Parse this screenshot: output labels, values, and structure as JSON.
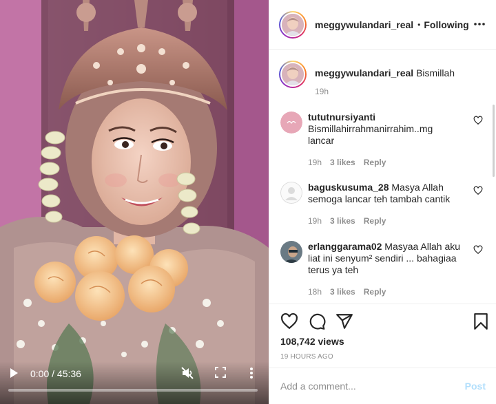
{
  "post": {
    "username": "meggywulandari_real",
    "follow_separator": "•",
    "follow_status": "Following",
    "caption": "Bismillah",
    "caption_time": "19h"
  },
  "video": {
    "current_time": "0:00",
    "duration": "45:36",
    "time_display": "0:00 / 45:36",
    "progress_fraction": 0.0,
    "icons": [
      "play-icon",
      "muted-speaker-icon",
      "fullscreen-icon",
      "more-vertical-icon"
    ]
  },
  "comments": [
    {
      "username": "tututnursiyanti",
      "text": "Bismillahirrahmanirrahim..mg lancar",
      "time": "19h",
      "likes": "3 likes",
      "reply": "Reply"
    },
    {
      "username": "baguskusuma_28",
      "text": "Masya Allah semoga lancar teh tambah cantik",
      "time": "19h",
      "likes": "3 likes",
      "reply": "Reply"
    },
    {
      "username": "erlanggarama02",
      "text": "Masyaa Allah aku liat ini senyum² sendiri ... bahagiaa terus ya teh",
      "time": "18h",
      "likes": "3 likes",
      "reply": "Reply"
    }
  ],
  "stats": {
    "views": "108,742 views",
    "posted": "19 HOURS AGO"
  },
  "add_comment": {
    "placeholder": "Add a comment...",
    "post_label": "Post"
  },
  "colors": {
    "text": "#262626",
    "muted": "#8e8e8e",
    "divider": "#efefef",
    "post_disabled": "#b2dffc",
    "background_wall": "#c978a8"
  }
}
